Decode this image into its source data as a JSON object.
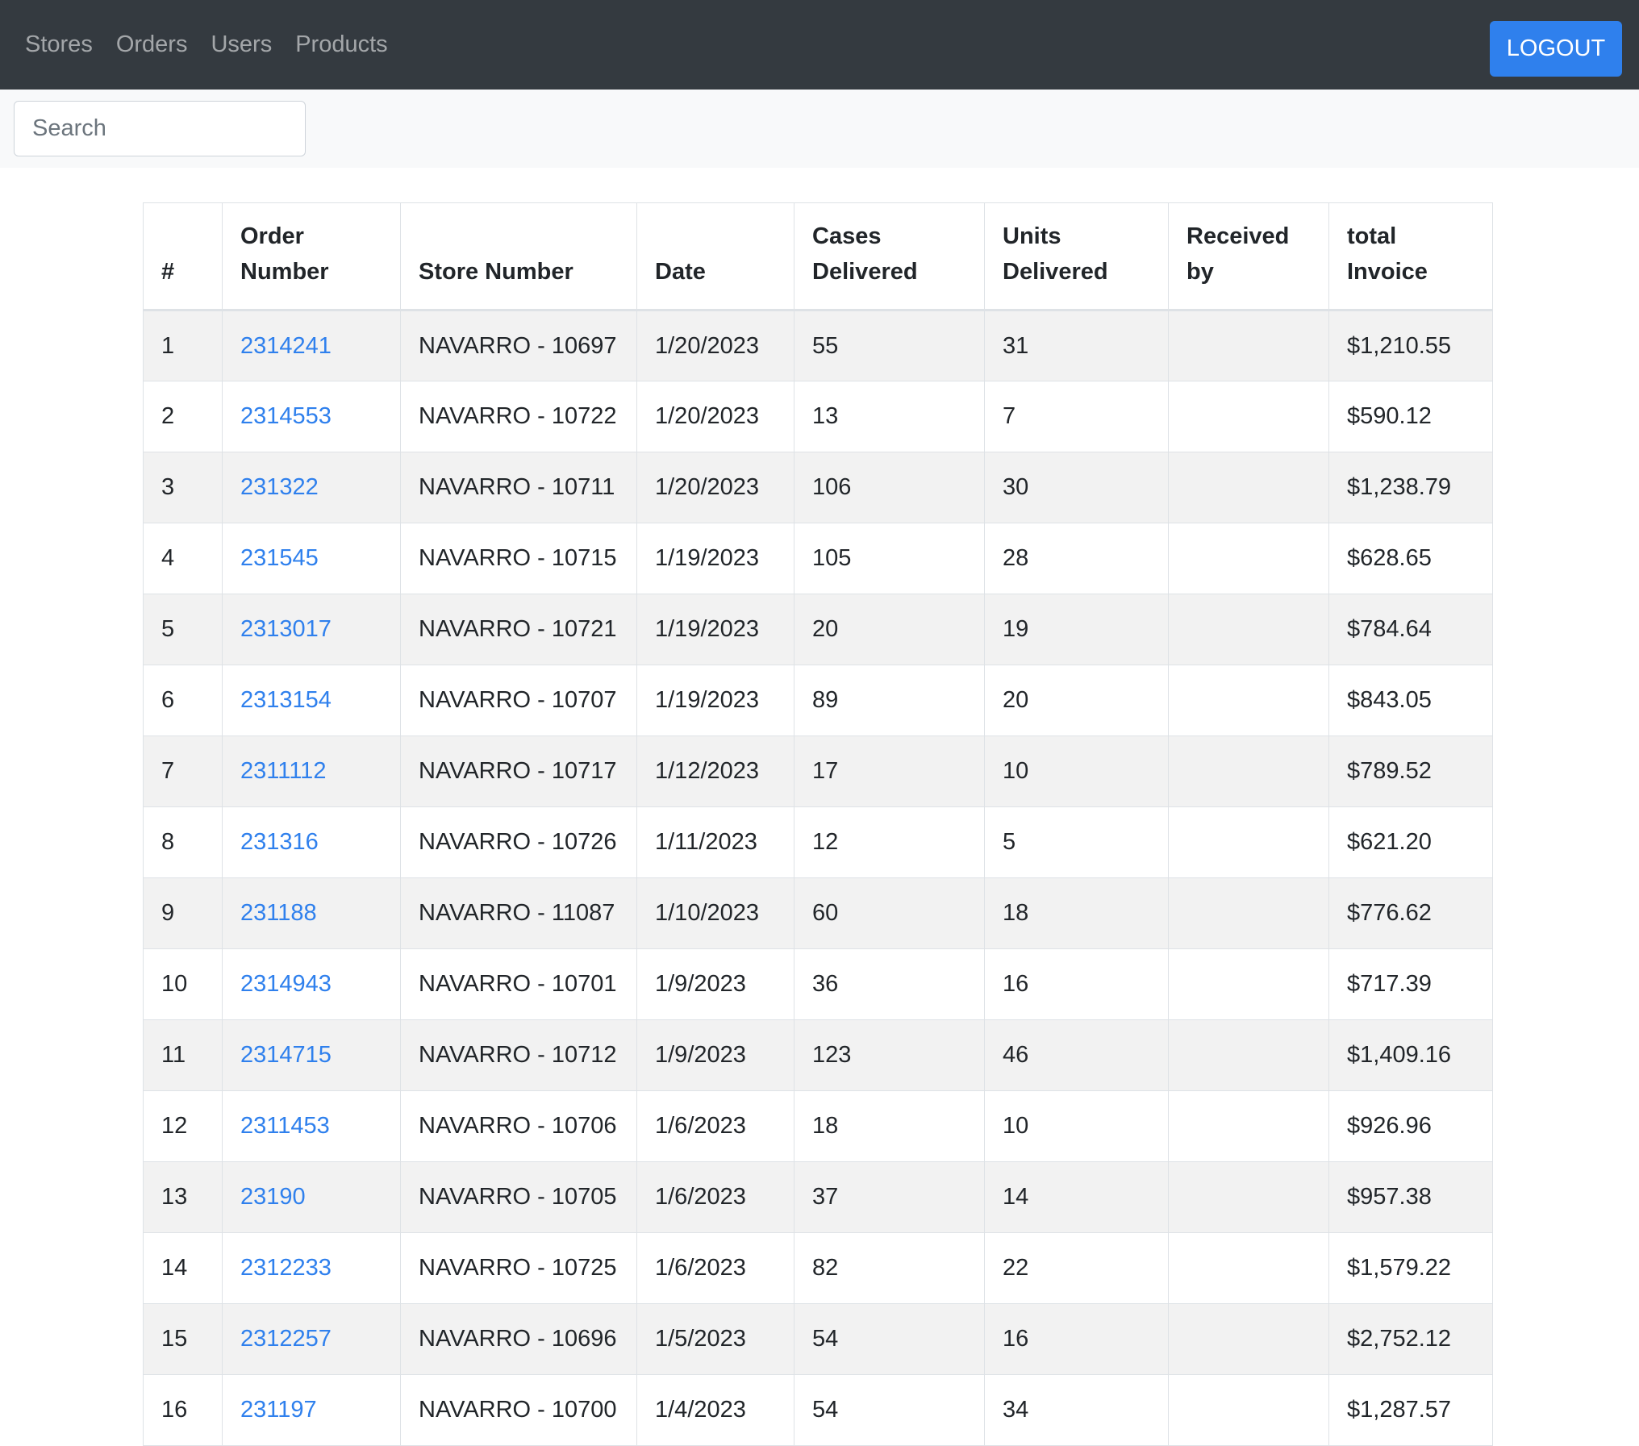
{
  "nav": {
    "links": [
      "Stores",
      "Orders",
      "Users",
      "Products"
    ],
    "logout_label": "LOGOUT"
  },
  "search": {
    "placeholder": "Search",
    "value": ""
  },
  "table": {
    "headers": [
      "#",
      "Order Number",
      "Store Number",
      "Date",
      "Cases Delivered",
      "Units Delivered",
      "Received by",
      "total Invoice"
    ],
    "rows": [
      [
        "1",
        "2314241",
        "NAVARRO - 10697",
        "1/20/2023",
        "55",
        "31",
        "",
        "$1,210.55"
      ],
      [
        "2",
        "2314553",
        "NAVARRO - 10722",
        "1/20/2023",
        "13",
        "7",
        "",
        "$590.12"
      ],
      [
        "3",
        "231322",
        "NAVARRO - 10711",
        "1/20/2023",
        "106",
        "30",
        "",
        "$1,238.79"
      ],
      [
        "4",
        "231545",
        "NAVARRO - 10715",
        "1/19/2023",
        "105",
        "28",
        "",
        "$628.65"
      ],
      [
        "5",
        "2313017",
        "NAVARRO - 10721",
        "1/19/2023",
        "20",
        "19",
        "",
        "$784.64"
      ],
      [
        "6",
        "2313154",
        "NAVARRO - 10707",
        "1/19/2023",
        "89",
        "20",
        "",
        "$843.05"
      ],
      [
        "7",
        "2311112",
        "NAVARRO - 10717",
        "1/12/2023",
        "17",
        "10",
        "",
        "$789.52"
      ],
      [
        "8",
        "231316",
        "NAVARRO - 10726",
        "1/11/2023",
        "12",
        "5",
        "",
        "$621.20"
      ],
      [
        "9",
        "231188",
        "NAVARRO - 11087",
        "1/10/2023",
        "60",
        "18",
        "",
        "$776.62"
      ],
      [
        "10",
        "2314943",
        "NAVARRO - 10701",
        "1/9/2023",
        "36",
        "16",
        "",
        "$717.39"
      ],
      [
        "11",
        "2314715",
        "NAVARRO - 10712",
        "1/9/2023",
        "123",
        "46",
        "",
        "$1,409.16"
      ],
      [
        "12",
        "2311453",
        "NAVARRO - 10706",
        "1/6/2023",
        "18",
        "10",
        "",
        "$926.96"
      ],
      [
        "13",
        "23190",
        "NAVARRO - 10705",
        "1/6/2023",
        "37",
        "14",
        "",
        "$957.38"
      ],
      [
        "14",
        "2312233",
        "NAVARRO - 10725",
        "1/6/2023",
        "82",
        "22",
        "",
        "$1,579.22"
      ],
      [
        "15",
        "2312257",
        "NAVARRO - 10696",
        "1/5/2023",
        "54",
        "16",
        "",
        "$2,752.12"
      ],
      [
        "16",
        "231197",
        "NAVARRO - 10700",
        "1/4/2023",
        "54",
        "34",
        "",
        "$1,287.57"
      ]
    ]
  }
}
